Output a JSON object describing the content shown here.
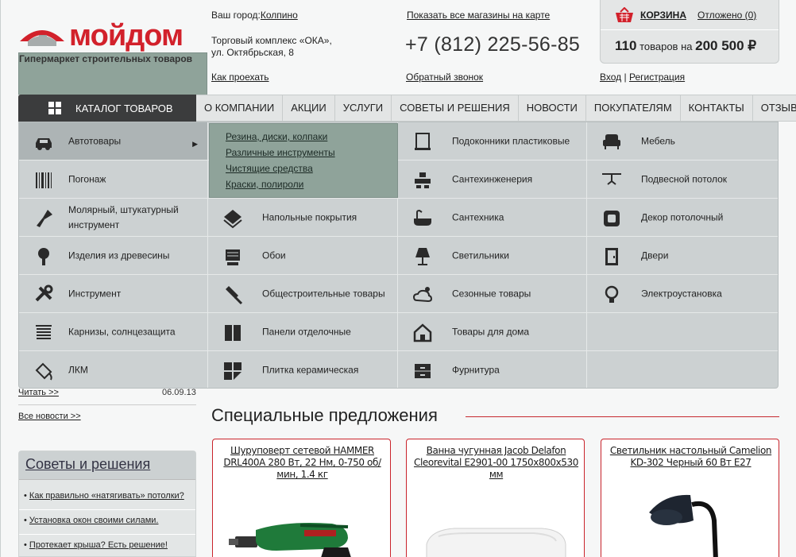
{
  "header": {
    "logo_name": "мойдом",
    "logo_tagline": "Гипермаркет строительных товаров",
    "city_label": "Ваш город:",
    "city_value": "Колпино",
    "address_line1": "Торговый комплекс «ОКА»,",
    "address_line2": "ул. Октябрьская, 8",
    "route_link": "Как проехать",
    "map_link": "Показать все магазины на карте",
    "phone": "+7 (812) 225-56-85",
    "callback_link": "Обратный звонок",
    "cart_label": "КОРЗИНА",
    "deferred_link": "Отложено (0)",
    "cart_count": "110",
    "cart_count_suffix": "товаров на",
    "cart_total": "200 500 ₽",
    "login_link": "Вход",
    "separator": "|",
    "register_link": "Регистрация"
  },
  "nav": {
    "catalog_label": "КАТАЛОГ ТОВАРОВ",
    "items": [
      "О КОМПАНИИ",
      "АКЦИИ",
      "УСЛУГИ",
      "СОВЕТЫ И РЕШЕНИЯ",
      "НОВОСТИ",
      "ПОКУПАТЕЛЯМ",
      "КОНТАКТЫ",
      "ОТЗЫВЫ"
    ]
  },
  "catalog": {
    "columns": [
      [
        {
          "label": "Автотовары",
          "icon": "car-icon",
          "active": true
        },
        {
          "label": "Погонаж",
          "icon": "molding-icon"
        },
        {
          "label": "Молярный, штукатурный инструмент",
          "icon": "paint-brush-icon"
        },
        {
          "label": "Изделия из древесины",
          "icon": "tree-icon"
        },
        {
          "label": "Инструмент",
          "icon": "wrench-icon"
        },
        {
          "label": "Карнизы, солнцезащита",
          "icon": "blinds-icon"
        },
        {
          "label": "ЛКМ",
          "icon": "paint-bucket-icon"
        }
      ],
      [
        {
          "label": "",
          "icon": ""
        },
        {
          "label": "",
          "icon": ""
        },
        {
          "label": "Напольные покрытия",
          "icon": "floor-icon"
        },
        {
          "label": "Обои",
          "icon": "wallpaper-icon"
        },
        {
          "label": "Общестроительные товары",
          "icon": "trowel-icon"
        },
        {
          "label": "Панели отделочные",
          "icon": "panel-icon"
        },
        {
          "label": "Плитка керамическая",
          "icon": "tile-icon"
        }
      ],
      [
        {
          "label": "Подоконники пластиковые",
          "icon": "windowsill-icon"
        },
        {
          "label": "Сантехинженерия",
          "icon": "pipes-icon"
        },
        {
          "label": "Сантехника",
          "icon": "bathtub-icon"
        },
        {
          "label": "Светильники",
          "icon": "lamp-icon"
        },
        {
          "label": "Сезонные товары",
          "icon": "weather-icon"
        },
        {
          "label": "Товары для дома",
          "icon": "house-icon"
        },
        {
          "label": "Фурнитура",
          "icon": "drawer-icon"
        }
      ],
      [
        {
          "label": "Мебель",
          "icon": "armchair-icon"
        },
        {
          "label": "Подвесной потолок",
          "icon": "ceiling-icon"
        },
        {
          "label": "Декор потолочный",
          "icon": "ceiling-decor-icon"
        },
        {
          "label": "Двери",
          "icon": "door-icon"
        },
        {
          "label": "Электроустановка",
          "icon": "bulb-icon"
        },
        {
          "label": "",
          "icon": ""
        },
        {
          "label": "",
          "icon": ""
        }
      ]
    ],
    "submenu": [
      "Резина, диски, колпаки",
      "Различные инструменты",
      "Чистящие средства",
      "Краски, полироли"
    ]
  },
  "news": {
    "read_more": "Читать >>",
    "date": "06.09.13",
    "all_news": "Все новости >>"
  },
  "tips": {
    "title": "Советы и решения",
    "items": [
      "Как правильно «натягивать» потолки?",
      "Установка окон своими силами.",
      "Протекает крыша? Есть решение!"
    ]
  },
  "specials": {
    "title": "Специальные предложения",
    "cards": [
      {
        "title": "Шуруповерт сетевой HAMMER DRL400A 280 Вт, 22 Нм, 0-750 об/мин, 1.4 кг",
        "image": "drill"
      },
      {
        "title": "Ванна чугунная Jacob Delafon Cleorevital E2901-00 1750х800х530 мм",
        "image": "bathtub"
      },
      {
        "title": "Светильник настольный Camelion KD-302 Черный 60 Вт E27",
        "image": "desk-lamp"
      }
    ]
  },
  "colors": {
    "brand_red": "#d2212b",
    "menu_bg": "#ccd1d2",
    "nav_dark": "#3b3c3d",
    "submenu_bg": "#8fa39a"
  }
}
